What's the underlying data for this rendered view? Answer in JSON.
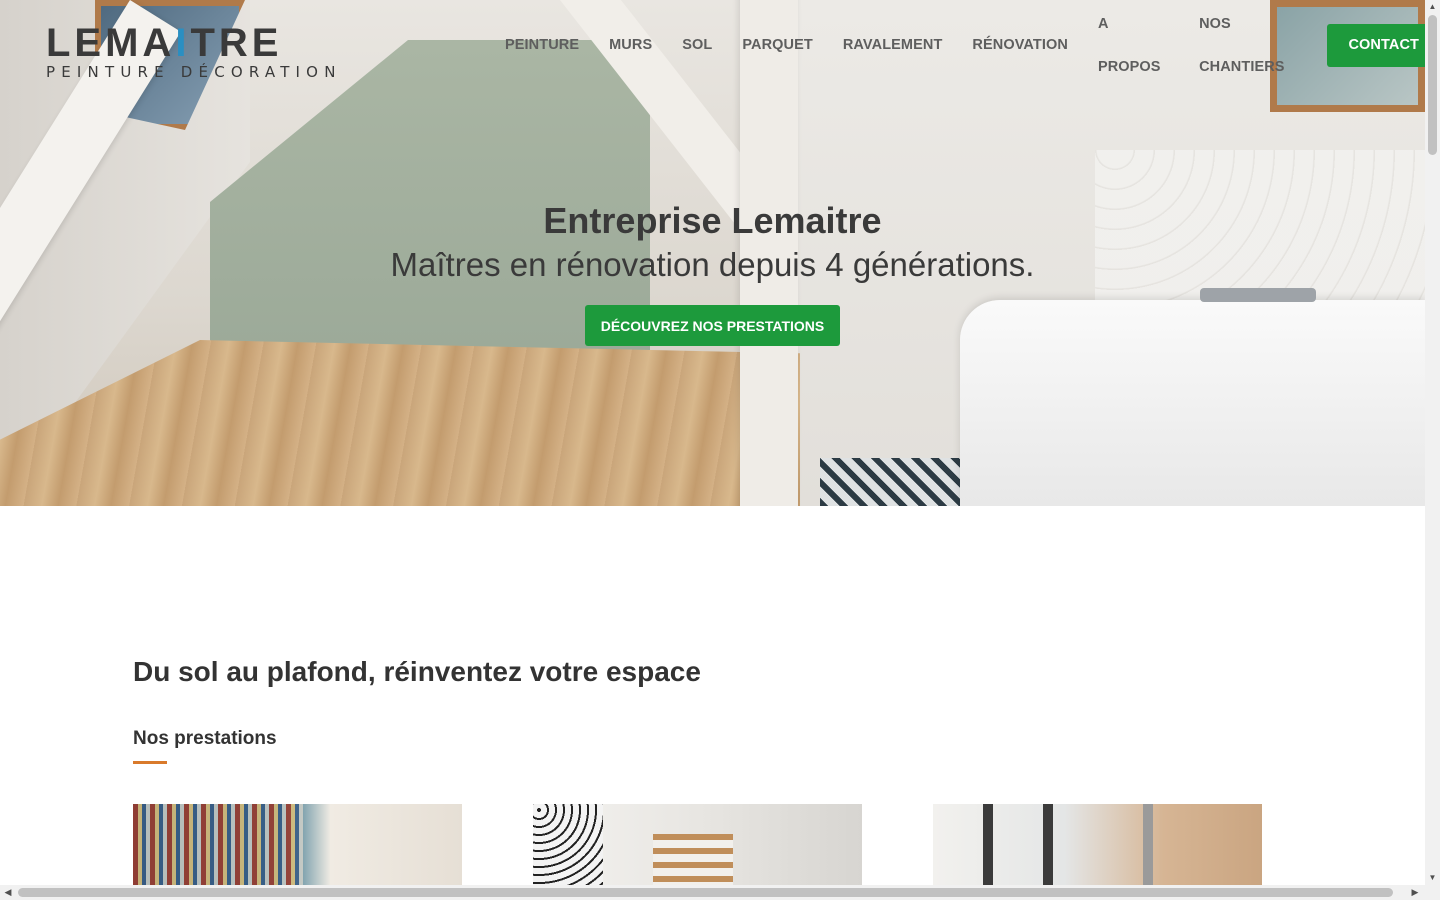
{
  "logo": {
    "main_pre": "LEMA",
    "main_accent": "I",
    "main_post": "TRE",
    "sub": "PEINTURE DÉCORATION"
  },
  "nav": {
    "items": [
      {
        "label": "PEINTURE"
      },
      {
        "label": "MURS"
      },
      {
        "label": "SOL"
      },
      {
        "label": "PARQUET"
      },
      {
        "label": "RAVALEMENT"
      },
      {
        "label": "RÉNOVATION"
      },
      {
        "label": "A PROPOS"
      },
      {
        "label": "NOS CHANTIERS"
      }
    ],
    "contact_label": "CONTACT"
  },
  "hero": {
    "title": "Entreprise Lemaitre",
    "subtitle": "Maîtres en rénovation depuis 4 générations.",
    "cta_label": "DÉCOUVREZ NOS PRESTATIONS"
  },
  "main": {
    "heading": "Du sol au plafond, réinventez votre espace",
    "subheading": "Nos prestations"
  },
  "colors": {
    "accent_green": "#1d9a3c",
    "underline_orange": "#d97a2b",
    "logo_blue": "#2a8fc2",
    "text_dark": "#333333"
  },
  "icons": {
    "scroll_up": "triangle-up-icon",
    "scroll_down": "triangle-down-icon",
    "scroll_left": "triangle-left-icon",
    "scroll_right": "triangle-right-icon"
  }
}
